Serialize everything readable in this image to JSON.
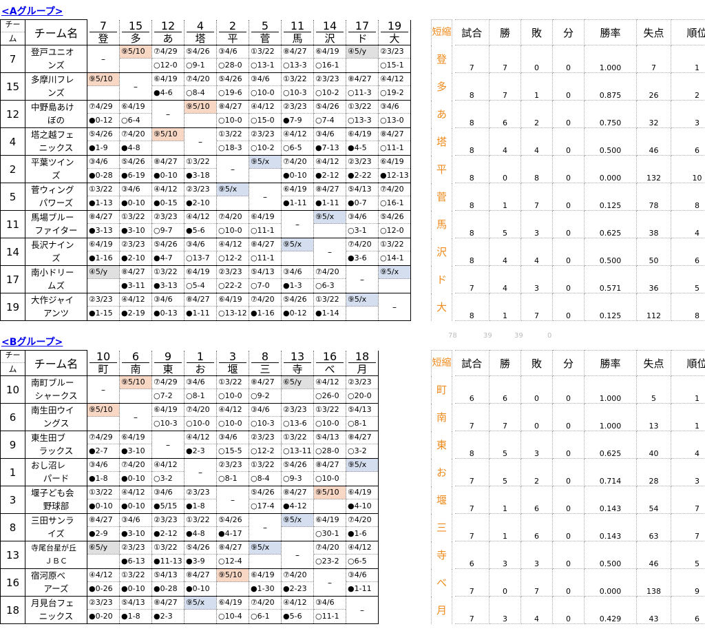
{
  "groupA": {
    "title": "<Aグループ>",
    "header": {
      "team_top": "チー",
      "team_bot": "ム",
      "name": "チーム名",
      "cols": [
        {
          "n": "7",
          "a": "登"
        },
        {
          "n": "15",
          "a": "多"
        },
        {
          "n": "12",
          "a": "あ"
        },
        {
          "n": "4",
          "a": "塔"
        },
        {
          "n": "2",
          "a": "平"
        },
        {
          "n": "5",
          "a": "菅"
        },
        {
          "n": "11",
          "a": "馬"
        },
        {
          "n": "14",
          "a": "沢"
        },
        {
          "n": "17",
          "a": "ド"
        },
        {
          "n": "19",
          "a": "大"
        }
      ],
      "abbr": "短縮",
      "stats": [
        "試合",
        "勝",
        "敗",
        "分",
        "勝率",
        "失点",
        "順位"
      ]
    },
    "rows": [
      {
        "no": "7",
        "name1": "登戸ユニオ",
        "name2": "ンズ",
        "abbr": "登",
        "stats": [
          "7",
          "7",
          "0",
          "0",
          "1.000",
          "7",
          "1"
        ],
        "cells": [
          [
            "",
            ""
          ],
          [
            "⑨5/10",
            ""
          ],
          [
            "⑦4/29",
            "○12-0"
          ],
          [
            "⑤4/26",
            "○9-1"
          ],
          [
            "③4/6",
            "○28-0"
          ],
          [
            "①3/22",
            "○13-1"
          ],
          [
            "⑧4/27",
            "○13-3"
          ],
          [
            "⑥4/19",
            "○16-1"
          ],
          [
            "④5/y",
            ""
          ],
          [
            "②3/23",
            "○15-1"
          ]
        ]
      },
      {
        "no": "15",
        "name1": "多摩川フレ",
        "name2": "ンズ",
        "abbr": "多",
        "stats": [
          "8",
          "7",
          "1",
          "0",
          "0.875",
          "26",
          "2"
        ],
        "cells": [
          [
            "⑨5/10",
            ""
          ],
          [
            "",
            ""
          ],
          [
            "⑥4/19",
            "●4-6"
          ],
          [
            "⑦4/20",
            "○8-4"
          ],
          [
            "⑤4/26",
            "○19-6"
          ],
          [
            "③4/6",
            "○10-0"
          ],
          [
            "①3/22",
            "○10-3"
          ],
          [
            "②3/23",
            "○10-2"
          ],
          [
            "⑧4/27",
            "○11-3"
          ],
          [
            "④4/12",
            "○19-2"
          ]
        ]
      },
      {
        "no": "12",
        "name1": "中野島あけ",
        "name2": "ぼの",
        "abbr": "あ",
        "stats": [
          "8",
          "6",
          "2",
          "0",
          "0.750",
          "32",
          "3"
        ],
        "cells": [
          [
            "⑦4/29",
            "●0-12"
          ],
          [
            "⑥4/19",
            "○6-4"
          ],
          [
            "",
            ""
          ],
          [
            "⑨5/10",
            ""
          ],
          [
            "⑧4/27",
            "○10-0"
          ],
          [
            "④4/12",
            "○15-0"
          ],
          [
            "②3/23",
            "●7-9"
          ],
          [
            "⑤4/26",
            "○7-4"
          ],
          [
            "①3/22",
            "○13-3"
          ],
          [
            "③4/6",
            "○13-0"
          ]
        ]
      },
      {
        "no": "4",
        "name1": "塔之越フェ",
        "name2": "ニックス",
        "abbr": "塔",
        "stats": [
          "8",
          "4",
          "4",
          "0",
          "0.500",
          "46",
          "6"
        ],
        "cells": [
          [
            "⑤4/26",
            "●1-9"
          ],
          [
            "⑦4/20",
            "●4-8"
          ],
          [
            "⑨5/10",
            ""
          ],
          [
            "",
            ""
          ],
          [
            "①3/22",
            "○18-3"
          ],
          [
            "②3/23",
            "○10-2"
          ],
          [
            "④4/12",
            "○6-5"
          ],
          [
            "③4/6",
            "●7-13"
          ],
          [
            "⑥4/19",
            "●4-5"
          ],
          [
            "⑧4/27",
            "○11-1"
          ]
        ]
      },
      {
        "no": "2",
        "name1": "平葉ツイン",
        "name2": "ズ",
        "abbr": "平",
        "stats": [
          "8",
          "0",
          "8",
          "0",
          "0.000",
          "132",
          "10"
        ],
        "cells": [
          [
            "③4/6",
            "●0-28"
          ],
          [
            "⑤4/26",
            "●6-19"
          ],
          [
            "⑧4/27",
            "●0-10"
          ],
          [
            "①3/22",
            "●3-18"
          ],
          [
            "",
            ""
          ],
          [
            "⑨5/x",
            ""
          ],
          [
            "⑦4/20",
            "●0-10"
          ],
          [
            "④4/12",
            "●2-12"
          ],
          [
            "②3/23",
            "●2-22"
          ],
          [
            "⑥4/19",
            "●12-13"
          ]
        ]
      },
      {
        "no": "5",
        "name1": "菅ウィング",
        "name2": "パワーズ",
        "abbr": "菅",
        "stats": [
          "8",
          "1",
          "7",
          "0",
          "0.125",
          "78",
          "8"
        ],
        "cells": [
          [
            "①3/22",
            "●1-13"
          ],
          [
            "③4/6",
            "●0-10"
          ],
          [
            "④4/12",
            "●0-15"
          ],
          [
            "②3/23",
            "●2-10"
          ],
          [
            "⑨5/x",
            ""
          ],
          [
            "",
            ""
          ],
          [
            "⑥4/19",
            "●1-11"
          ],
          [
            "⑧4/27",
            "●1-11"
          ],
          [
            "⑤4/13",
            "●0-7"
          ],
          [
            "⑦4/20",
            "○16-1"
          ]
        ]
      },
      {
        "no": "11",
        "name1": "馬場ブルー",
        "name2": "ファイター",
        "abbr": "馬",
        "stats": [
          "8",
          "5",
          "3",
          "0",
          "0.625",
          "38",
          "4"
        ],
        "cells": [
          [
            "⑧4/27",
            "●3-13"
          ],
          [
            "①3/22",
            "●3-10"
          ],
          [
            "②3/23",
            "○9-7"
          ],
          [
            "④4/12",
            "●5-6"
          ],
          [
            "⑦4/20",
            "○10-0"
          ],
          [
            "⑥4/19",
            "○11-1"
          ],
          [
            "",
            ""
          ],
          [
            "⑨5/x",
            ""
          ],
          [
            "③4/6",
            "○3-1"
          ],
          [
            "⑤4/26",
            "○12-0"
          ]
        ]
      },
      {
        "no": "14",
        "name1": "長沢ナイン",
        "name2": "ズ",
        "abbr": "沢",
        "stats": [
          "8",
          "4",
          "4",
          "0",
          "0.500",
          "50",
          "6"
        ],
        "cells": [
          [
            "⑥4/19",
            "●1-16"
          ],
          [
            "②3/23",
            "●2-10"
          ],
          [
            "⑤4/26",
            "●4-7"
          ],
          [
            "③4/6",
            "○13-7"
          ],
          [
            "④4/12",
            "○12-2"
          ],
          [
            "⑧4/27",
            "○11-1"
          ],
          [
            "⑨5/x",
            ""
          ],
          [
            "",
            ""
          ],
          [
            "⑦4/20",
            "●3-6"
          ],
          [
            "①3/22",
            "○14-1"
          ]
        ]
      },
      {
        "no": "17",
        "name1": "南小ドリー",
        "name2": "ムズ",
        "abbr": "ド",
        "stats": [
          "7",
          "4",
          "3",
          "0",
          "0.571",
          "36",
          "5"
        ],
        "cells": [
          [
            "④5/y",
            ""
          ],
          [
            "⑧4/27",
            "●3-11"
          ],
          [
            "①3/22",
            "●3-13"
          ],
          [
            "⑥4/19",
            "○5-4"
          ],
          [
            "②3/23",
            "○22-2"
          ],
          [
            "⑤4/13",
            "○7-0"
          ],
          [
            "③4/6",
            "●1-3"
          ],
          [
            "⑦4/20",
            "○6-3"
          ],
          [
            "",
            ""
          ],
          [
            "⑨5/x",
            ""
          ]
        ]
      },
      {
        "no": "19",
        "name1": "大作ジャイ",
        "name2": "アンツ",
        "abbr": "大",
        "stats": [
          "8",
          "1",
          "7",
          "0",
          "0.125",
          "112",
          "8"
        ],
        "cells": [
          [
            "②3/23",
            "●1-15"
          ],
          [
            "④4/12",
            "●2-19"
          ],
          [
            "③4/6",
            "●0-13"
          ],
          [
            "⑧4/27",
            "●1-11"
          ],
          [
            "⑥4/19",
            "○13-12"
          ],
          [
            "⑦4/20",
            "●1-16"
          ],
          [
            "⑤4/26",
            "●0-12"
          ],
          [
            "①3/22",
            "●1-14"
          ],
          [
            "⑨5/x",
            ""
          ],
          [
            "",
            ""
          ]
        ]
      }
    ],
    "totals": [
      "78",
      "39",
      "39",
      "0"
    ]
  },
  "groupB": {
    "title": "<Bグループ>",
    "header": {
      "team_top": "チー",
      "team_bot": "ム",
      "name": "チーム名",
      "cols": [
        {
          "n": "10",
          "a": "町"
        },
        {
          "n": "6",
          "a": "南"
        },
        {
          "n": "9",
          "a": "東"
        },
        {
          "n": "1",
          "a": "お"
        },
        {
          "n": "3",
          "a": "堰"
        },
        {
          "n": "8",
          "a": "三"
        },
        {
          "n": "13",
          "a": "寺"
        },
        {
          "n": "16",
          "a": "べ"
        },
        {
          "n": "18",
          "a": "月"
        }
      ],
      "abbr": "短縮",
      "stats": [
        "試合",
        "勝",
        "敗",
        "分",
        "勝率",
        "失点",
        "順位"
      ]
    },
    "rows": [
      {
        "no": "10",
        "name1": "南町ブルー",
        "name2": "シャークス",
        "abbr": "町",
        "stats": [
          "6",
          "6",
          "0",
          "0",
          "1.000",
          "5",
          "1"
        ],
        "cells": [
          [
            "",
            ""
          ],
          [
            "⑨5/10",
            ""
          ],
          [
            "⑦4/29",
            "○7-2"
          ],
          [
            "③4/6",
            "○8-1"
          ],
          [
            "①3/22",
            "○10-0"
          ],
          [
            "⑧4/27",
            "○9-2"
          ],
          [
            "⑥5/y",
            ""
          ],
          [
            "④4/12",
            "○26-0"
          ],
          [
            "②3/23",
            "○20-0"
          ]
        ]
      },
      {
        "no": "6",
        "name1": "南生田ウイ",
        "name2": "ングス",
        "abbr": "南",
        "stats": [
          "7",
          "7",
          "0",
          "0",
          "1.000",
          "13",
          "1"
        ],
        "cells": [
          [
            "⑨5/10",
            ""
          ],
          [
            "",
            ""
          ],
          [
            "⑥4/19",
            "○10-3"
          ],
          [
            "⑦4/20",
            "○10-0"
          ],
          [
            "④4/12",
            "○10-0"
          ],
          [
            "③4/6",
            "○10-3"
          ],
          [
            "②3/23",
            "○13-6"
          ],
          [
            "①3/22",
            "○10-0"
          ],
          [
            "⑤4/13",
            "○8-1"
          ]
        ]
      },
      {
        "no": "9",
        "name1": "東生田ブ",
        "name2": "ラックス",
        "abbr": "東",
        "stats": [
          "8",
          "5",
          "3",
          "0",
          "0.625",
          "40",
          "4"
        ],
        "cells": [
          [
            "⑦4/29",
            "●2-7"
          ],
          [
            "⑥4/19",
            "●3-10"
          ],
          [
            "",
            ""
          ],
          [
            "④4/12",
            "●2-3"
          ],
          [
            "③4/6",
            "○15-5"
          ],
          [
            "②3/23",
            "○12-2"
          ],
          [
            "①3/22",
            "○13-11"
          ],
          [
            "⑤4/13",
            "○28-0"
          ],
          [
            "⑧4/27",
            "○3-2"
          ]
        ]
      },
      {
        "no": "1",
        "name1": "おし沼レ",
        "name2": "パード",
        "abbr": "お",
        "stats": [
          "7",
          "5",
          "2",
          "0",
          "0.714",
          "28",
          "3"
        ],
        "cells": [
          [
            "③4/6",
            "●1-8"
          ],
          [
            "⑦4/20",
            "●0-10"
          ],
          [
            "④4/12",
            "○3-2"
          ],
          [
            "",
            ""
          ],
          [
            "②3/23",
            "○8-1"
          ],
          [
            "①3/22",
            "○8-4"
          ],
          [
            "⑤4/26",
            "○9-3"
          ],
          [
            "⑧4/27",
            "○10-0"
          ],
          [
            "⑨5/x",
            ""
          ]
        ]
      },
      {
        "no": "3",
        "name1": "堰子ども会",
        "name2": "野球部",
        "abbr": "堰",
        "stats": [
          "7",
          "1",
          "6",
          "0",
          "0.143",
          "54",
          "7"
        ],
        "cells": [
          [
            "①3/22",
            "●0-10"
          ],
          [
            "④4/12",
            "●0-10"
          ],
          [
            "③4/6",
            "●5/15"
          ],
          [
            "②3/23",
            "●1-8"
          ],
          [
            "",
            ""
          ],
          [
            "⑤4/26",
            "○17-4"
          ],
          [
            "⑧4/27",
            "●4-12"
          ],
          [
            "⑨5/10",
            ""
          ],
          [
            "⑥4/19",
            "●4-10"
          ]
        ]
      },
      {
        "no": "8",
        "name1": "三田サンラ",
        "name2": "イズ",
        "abbr": "三",
        "stats": [
          "7",
          "1",
          "6",
          "0",
          "0.143",
          "63",
          "7"
        ],
        "cells": [
          [
            "⑧4/27",
            "●2-9"
          ],
          [
            "③4/6",
            "●3-10"
          ],
          [
            "②3/23",
            "●2-12"
          ],
          [
            "①3/22",
            "●4-8"
          ],
          [
            "⑤4/26",
            "●4-17"
          ],
          [
            "",
            ""
          ],
          [
            "⑨5/x",
            ""
          ],
          [
            "⑥4/19",
            "○30-1"
          ],
          [
            "⑦4/20",
            "●1-6"
          ]
        ]
      },
      {
        "no": "13",
        "name1": "寺尾台星が丘",
        "name2": "ＪＢＣ",
        "abbr": "寺",
        "stats": [
          "6",
          "3",
          "3",
          "0",
          "0.500",
          "46",
          "5"
        ],
        "cells": [
          [
            "⑥5/y",
            ""
          ],
          [
            "②3/23",
            "●6-13"
          ],
          [
            "①3/22",
            "●11-13"
          ],
          [
            "⑤4/26",
            "●3-9"
          ],
          [
            "⑧4/27",
            "○12-4"
          ],
          [
            "⑨5/x",
            ""
          ],
          [
            "",
            ""
          ],
          [
            "⑦4/20",
            "○23-2"
          ],
          [
            "④4/12",
            "○6-5"
          ]
        ]
      },
      {
        "no": "16",
        "name1": "宿河原べ",
        "name2": "アーズ",
        "abbr": "べ",
        "stats": [
          "7",
          "0",
          "7",
          "0",
          "0.000",
          "138",
          "9"
        ],
        "cells": [
          [
            "④4/12",
            "●0-26"
          ],
          [
            "①3/22",
            "●0-10"
          ],
          [
            "⑤4/13",
            "●0-28"
          ],
          [
            "⑧4/27",
            "●0-10"
          ],
          [
            "⑨5/10",
            ""
          ],
          [
            "⑥4/19",
            "●1-30"
          ],
          [
            "⑦4/20",
            "●2-23"
          ],
          [
            "",
            ""
          ],
          [
            "③4/6",
            "●1-11"
          ]
        ]
      },
      {
        "no": "18",
        "name1": "月見台フェ",
        "name2": "ニックス",
        "abbr": "月",
        "stats": [
          "7",
          "3",
          "4",
          "0",
          "0.429",
          "43",
          "6"
        ],
        "cells": [
          [
            "②3/23",
            "●0-20"
          ],
          [
            "⑤4/13",
            "●1-8"
          ],
          [
            "⑧4/27",
            "●2-3"
          ],
          [
            "⑨5/x",
            ""
          ],
          [
            "⑥4/19",
            "○10-4"
          ],
          [
            "⑦4/20",
            "○6-1"
          ],
          [
            "④4/12",
            "●5-6"
          ],
          [
            "③4/6",
            "○11-1"
          ],
          [
            "",
            ""
          ]
        ]
      }
    ]
  }
}
